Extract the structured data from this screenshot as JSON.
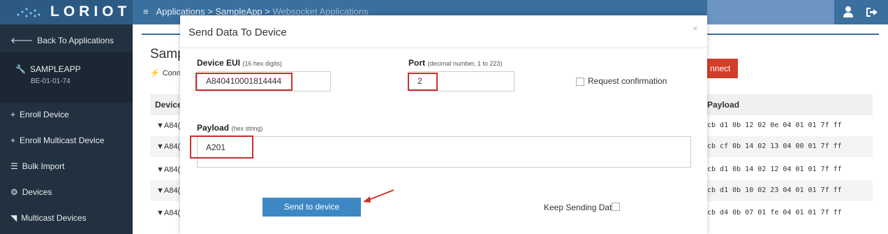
{
  "header": {
    "logo_text": "LORIOT",
    "breadcrumb": [
      "Applications",
      "SampleApp",
      "Websocket Applications"
    ],
    "separator": ">"
  },
  "sidebar": {
    "back": "Back To Applications",
    "app_name": "SAMPLEAPP",
    "app_id": "BE-01-01-74",
    "items": [
      "Enroll Device",
      "Enroll Multicast Device",
      "Bulk Import",
      "Devices",
      "Multicast Devices"
    ]
  },
  "page": {
    "title_partial": "Samp",
    "connection_partial": "Conn",
    "disconnect_partial": "nnect",
    "table": {
      "col_device_partial": "Device",
      "col_payload": "Payload",
      "rows": [
        {
          "device": "A84(",
          "payload": "cb d1 0b 12 02 0e 04 01 01 7f ff"
        },
        {
          "device": "A84(",
          "payload": "cb cf 0b 14 02 13 04 00 01 7f ff"
        },
        {
          "device": "A84(",
          "payload": "cb d1 0b 14 02 12 04 01 01 7f ff"
        },
        {
          "device": "A84(",
          "payload": "cb d1 0b 10 02 23 04 01 01 7f ff"
        },
        {
          "device": "A84(",
          "payload": "cb d4 0b 07 01 fe 04 01 01 7f ff"
        }
      ]
    }
  },
  "modal": {
    "title": "Send Data To Device",
    "close": "×",
    "device_eui": {
      "label": "Device EUI",
      "hint": "(16 hex digits)",
      "value": "A840410001814444"
    },
    "port": {
      "label": "Port",
      "hint": "(decimal number, 1 to 223)",
      "value": "2"
    },
    "request_confirmation": {
      "label": "Request confirmation",
      "checked": false
    },
    "payload": {
      "label": "Payload",
      "hint": "(hex string)",
      "value": "A201"
    },
    "send_button": "Send to device",
    "keep_sending": {
      "label": "Keep Sending Data",
      "checked": false
    }
  },
  "colors": {
    "topbar": "#3a6f9e",
    "sidebar": "#22313f",
    "accent": "#3d88c4",
    "highlight": "#c9302c",
    "danger": "#d23e2b"
  },
  "icons": [
    "menu-icon",
    "user-icon",
    "logout-icon",
    "arrow-left-icon",
    "wrench-icon",
    "plus-icon",
    "list-icon",
    "devices-icon",
    "rss-icon",
    "plug-icon",
    "filter-icon",
    "close-icon"
  ]
}
